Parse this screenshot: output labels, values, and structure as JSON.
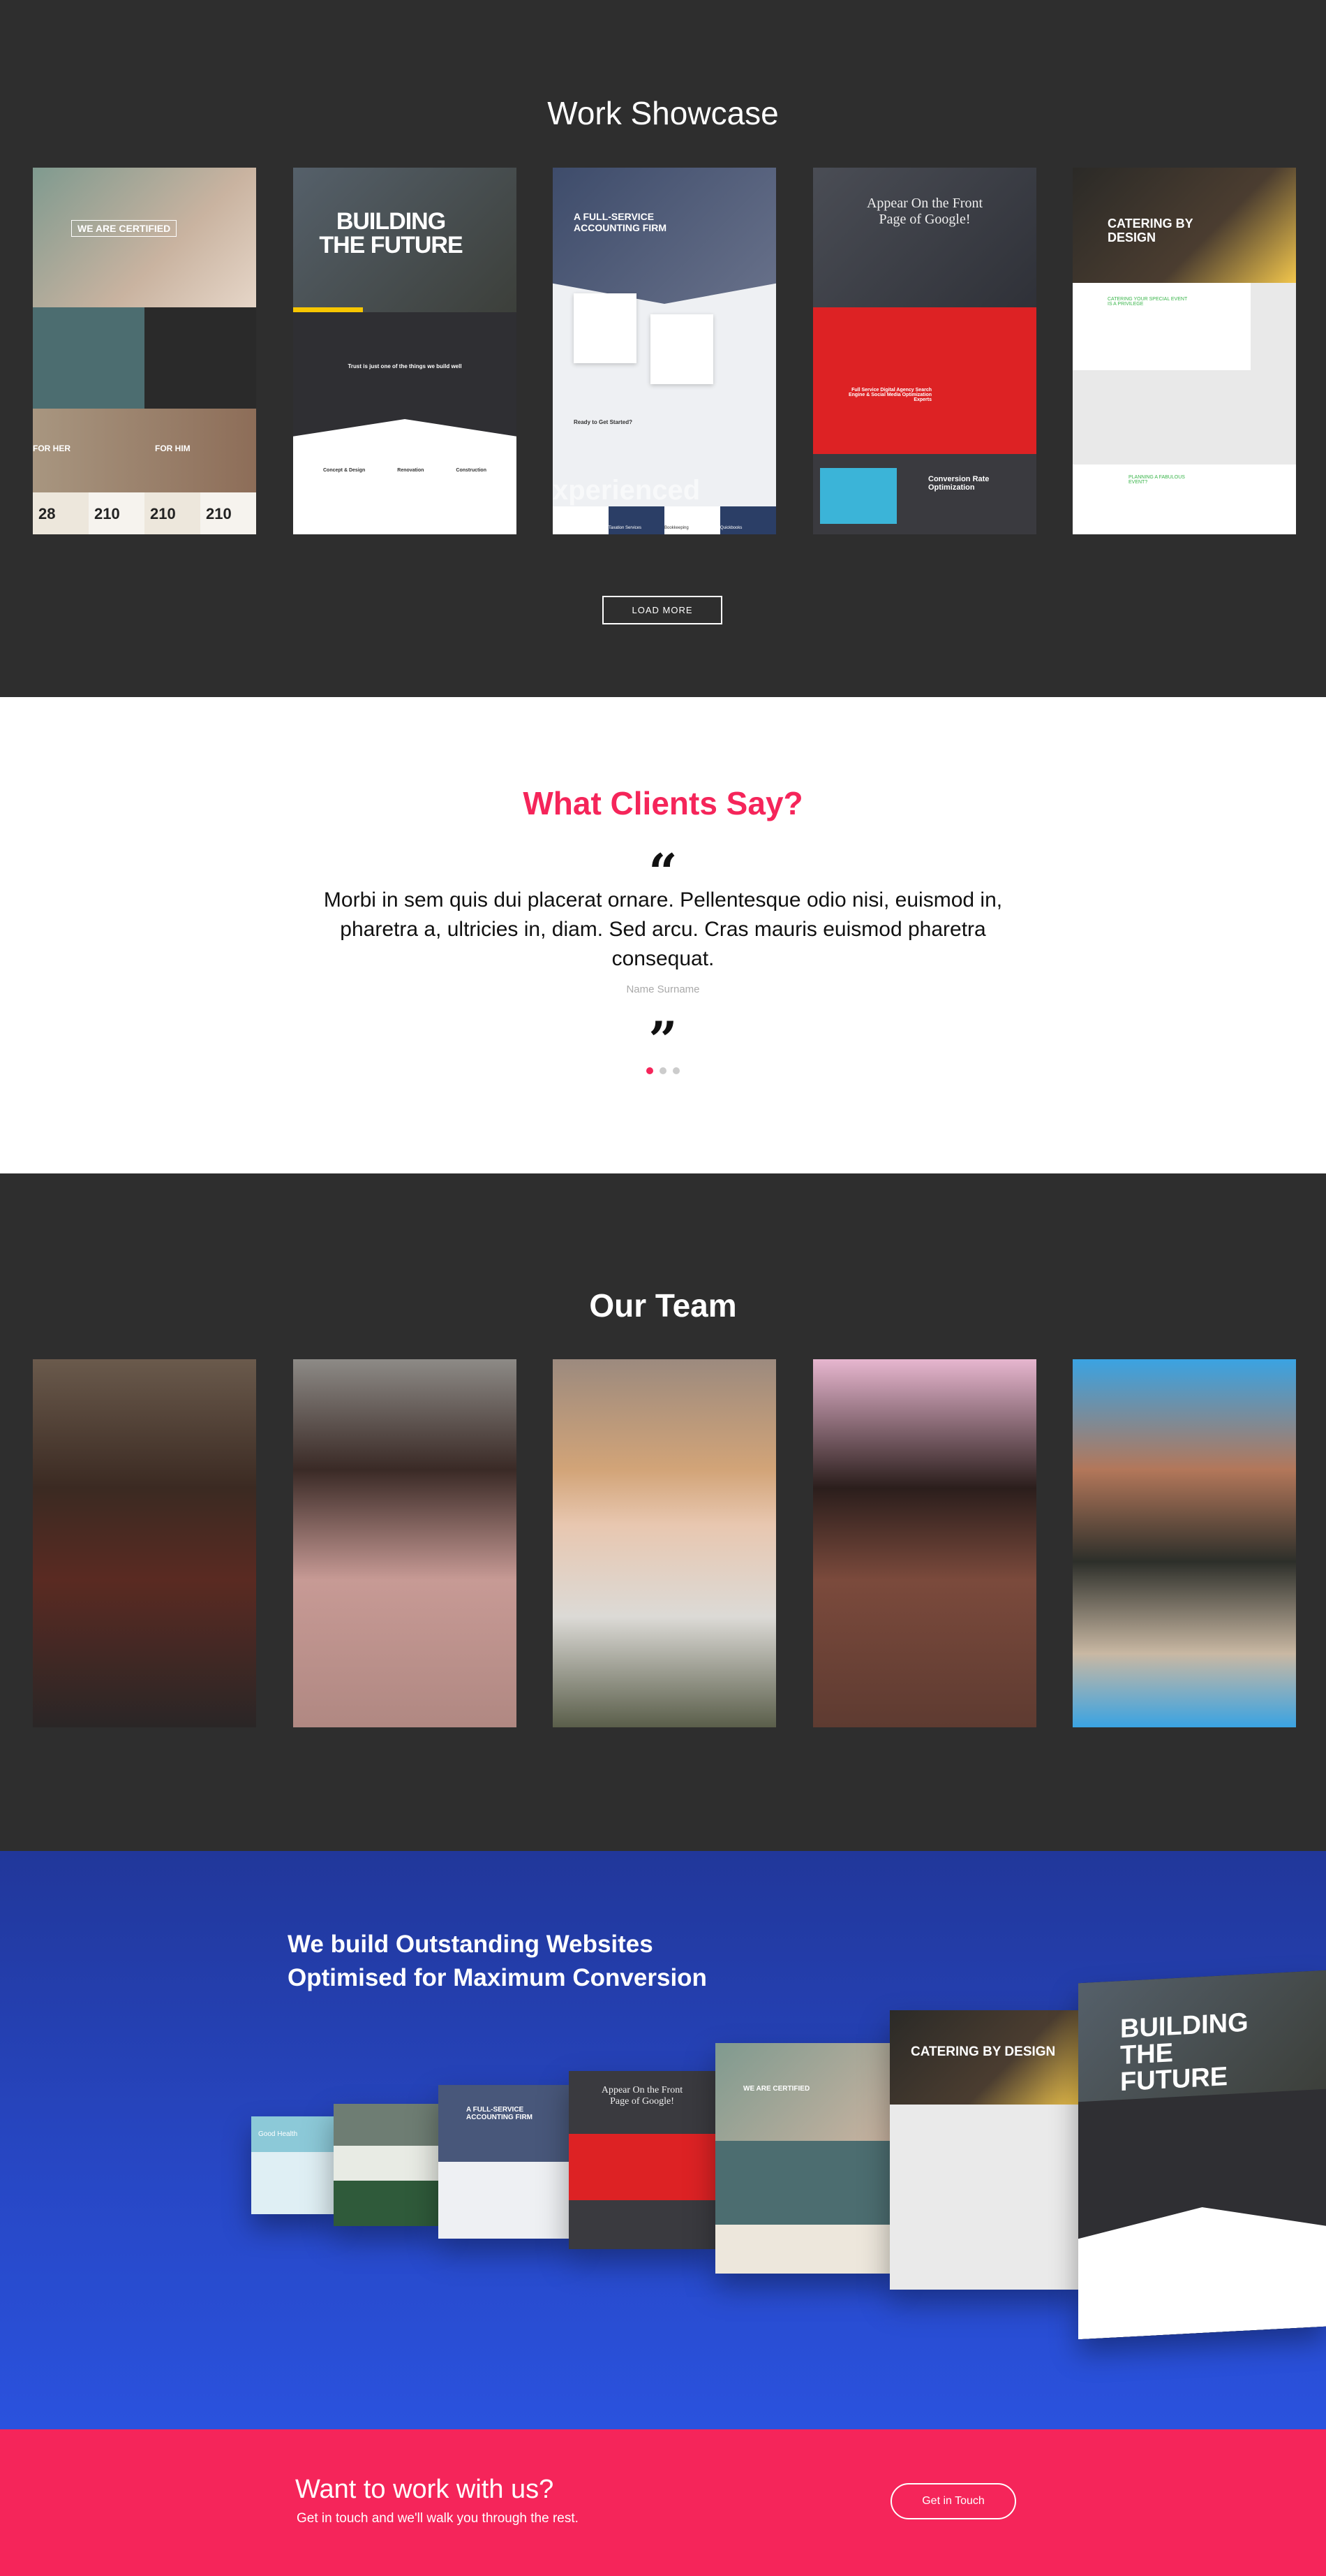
{
  "showcase": {
    "title": "Work Showcase",
    "load_more": "LOAD MORE",
    "cards": [
      {
        "headline": "WE ARE CERTIFIED",
        "labels": [
          "FOR HER",
          "FOR HIM"
        ],
        "stats": [
          "28",
          "210",
          "210",
          "210"
        ]
      },
      {
        "headline": "BUILDING THE FUTURE",
        "tagline": "Trust is just one of the things we build well",
        "features": [
          "Concept & Design",
          "Renovation",
          "Construction"
        ]
      },
      {
        "headline": "A FULL-SERVICE ACCOUNTING FIRM",
        "sub": "Ready to Get Started?",
        "watermark": "xperienced",
        "services": [
          "Taxation Services",
          "Bookkeeping",
          "Quickbooks"
        ]
      },
      {
        "headline": "Appear On the Front Page of Google!",
        "sub": "Full Service Digital Agency Search Engine & Social Media Optimization Experts",
        "bottom": "Conversion Rate Optimization"
      },
      {
        "headline": "CATERING BY DESIGN",
        "sub": "CATERING YOUR SPECIAL EVENT IS A PRIVILEGE",
        "bottom": "PLANNING A FABULOUS EVENT?"
      }
    ]
  },
  "clients": {
    "title": "What Clients Say?",
    "open_quote": "“",
    "quote": "Morbi in sem quis dui placerat ornare. Pellentesque odio nisi, euismod in, pharetra a, ultricies in, diam. Sed arcu. Cras mauris euismod pharetra consequat.",
    "author": "Name Surname",
    "close_quote": "”",
    "dots": 3,
    "active_dot": 0
  },
  "team": {
    "title": "Our Team",
    "members": 5
  },
  "promo": {
    "line1": "We build Outstanding Websites",
    "line2": "Optimised for Maximum Conversion",
    "mockups": [
      "Good Health",
      "",
      "A FULL-SERVICE ACCOUNTING FIRM",
      "Appear On the Front Page of Google!",
      "WE ARE CERTIFIED",
      "CATERING BY DESIGN",
      "BUILDING THE FUTURE"
    ]
  },
  "cta": {
    "title": "Want to work with us?",
    "subtitle": "Get in touch and we'll walk you through the rest.",
    "button": "Get in Touch"
  },
  "colors": {
    "accent": "#f5255a",
    "dark": "#2e2e2e",
    "blue": "#2747c4"
  }
}
